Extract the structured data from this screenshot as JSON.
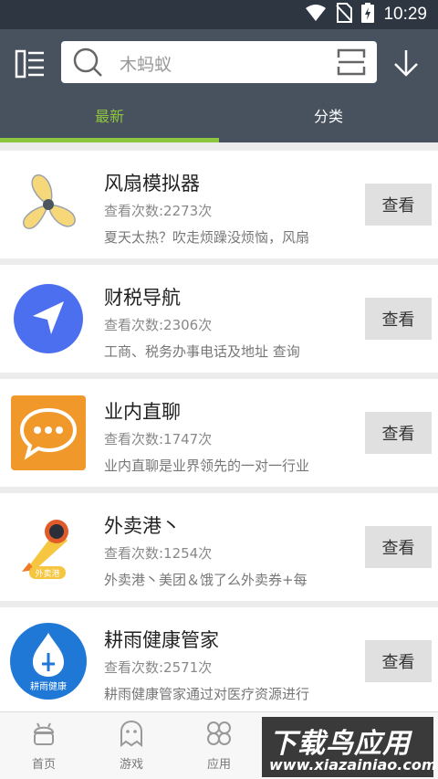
{
  "status_bar": {
    "time": "10:29",
    "icons": [
      "wifi-icon",
      "no-sim-icon",
      "battery-charging-icon"
    ]
  },
  "header": {
    "search_placeholder": "木蚂蚁",
    "icons": [
      "list-menu-icon",
      "search-icon",
      "scan-icon",
      "download-icon"
    ],
    "tabs": [
      {
        "label": "最新",
        "selected": true
      },
      {
        "label": "分类",
        "selected": false
      }
    ],
    "accent_color": "#8cc63e",
    "bar_color": "#48515e"
  },
  "apps": [
    {
      "name": "风扇模拟器",
      "views": "查看次数:2273次",
      "desc": "夏天太热？吹走烦躁没烦恼，风扇",
      "button": "查看",
      "icon": "fan-icon"
    },
    {
      "name": "财税导航",
      "views": "查看次数:2306次",
      "desc": "工商、税务办事电话及地址 查询",
      "button": "查看",
      "icon": "navigation-arrow-icon"
    },
    {
      "name": "业内直聊",
      "views": "查看次数:1747次",
      "desc": "业内直聊是业界领先的一对一行业",
      "button": "查看",
      "icon": "chat-bubble-icon"
    },
    {
      "name": "外卖港丶",
      "views": "查看次数:1254次",
      "desc": "外卖港丶美团＆饿了么外卖券+每",
      "button": "查看",
      "icon": "rocket-astronaut-icon",
      "icon_text": "外卖港"
    },
    {
      "name": "耕雨健康管家",
      "views": "查看次数:2571次",
      "desc": "耕雨健康管家通过对医疗资源进行",
      "button": "查看",
      "icon": "health-drop-icon",
      "icon_text": "耕雨健康"
    }
  ],
  "bottom_nav": [
    {
      "label": "首页",
      "icon": "android-robot-icon"
    },
    {
      "label": "游戏",
      "icon": "ghost-icon"
    },
    {
      "label": "应用",
      "icon": "apps-grid-icon"
    }
  ],
  "watermark": {
    "title": "下载鸟应用",
    "url": "www.xiazainiao.com"
  }
}
